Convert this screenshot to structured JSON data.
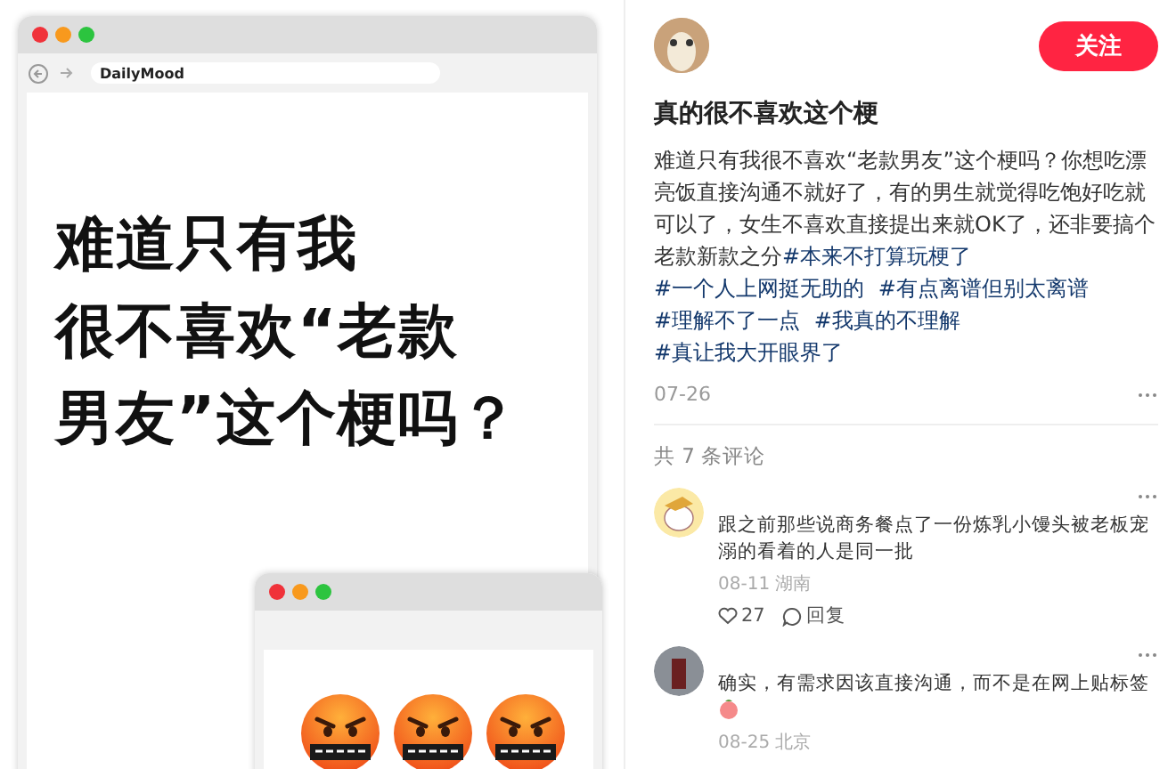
{
  "image": {
    "url": "DailyMood",
    "headline": [
      "难道只有我",
      "很不喜欢“老款",
      "男友”这个梗吗？"
    ]
  },
  "post": {
    "follow_button": "关注",
    "title": "真的很不喜欢这个梗",
    "body": "难道只有我很不喜欢“老款男友”这个梗吗？你想吃漂亮饭直接沟通不就好了，有的男生就觉得吃饱好吃就可以了，女生不喜欢直接提出来就OK了，还非要搞个老款新款之分",
    "tags": [
      "#本来不打算玩梗了",
      "#一个人上网挺无助的",
      "#有点离谱但别太离谱",
      "#理解不了一点",
      "#我真的不理解",
      "#真让我大开眼界了"
    ],
    "date": "07-26"
  },
  "comments_header": "共 7 条评论",
  "comments": [
    {
      "text": "跟之前那些说商务餐点了一份炼乳小馒头被老板宠溺的看着的人是同一批",
      "trailing_emoji": false,
      "meta": "08-11 湖南",
      "likes": "27",
      "reply": "回复"
    },
    {
      "text": "确实，有需求因该直接沟通，而不是在网上贴标签",
      "trailing_emoji": true,
      "meta": "08-25 北京"
    }
  ]
}
